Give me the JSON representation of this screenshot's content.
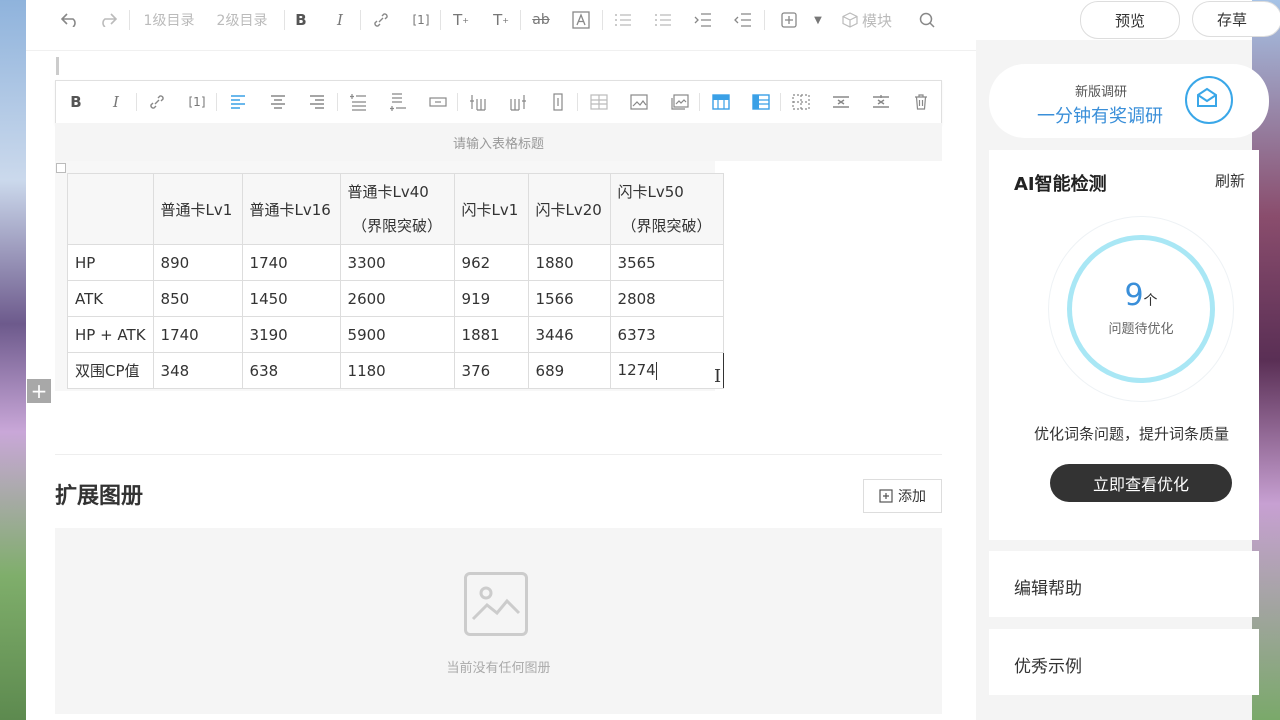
{
  "toolbar": {
    "heading1": "1级目录",
    "heading2": "2级目录",
    "module": "模块",
    "preview": "预览",
    "save": "存草"
  },
  "table_toolbar": {
    "icons": [
      "bold",
      "italic",
      "link",
      "reference",
      "align-left",
      "align-center",
      "align-right",
      "insert-row-above",
      "insert-row-below",
      "delete-row",
      "insert-col-left",
      "insert-col-right",
      "delete-col",
      "merge-cells",
      "image",
      "gallery",
      "header-row",
      "header-col",
      "split-cells",
      "delete-row-alt",
      "delete-col-alt",
      "delete-table"
    ]
  },
  "table": {
    "caption_placeholder": "请输入表格标题",
    "header": [
      "",
      "普通卡Lv1",
      "普通卡Lv16",
      "普通卡Lv40\n（界限突破）",
      "闪卡Lv1",
      "闪卡Lv20",
      "闪卡Lv50\n（界限突破）"
    ],
    "header_lines": [
      [
        ""
      ],
      [
        "普通卡Lv1"
      ],
      [
        "普通卡Lv16"
      ],
      [
        "普通卡Lv40",
        "（界限突破）"
      ],
      [
        "闪卡Lv1"
      ],
      [
        "闪卡Lv20"
      ],
      [
        "闪卡Lv50",
        "（界限突破）"
      ]
    ],
    "rows": [
      [
        "HP",
        "890",
        "1740",
        "3300",
        "962",
        "1880",
        "3565"
      ],
      [
        "ATK",
        "850",
        "1450",
        "2600",
        "919",
        "1566",
        "2808"
      ],
      [
        "HP + ATK",
        "1740",
        "3190",
        "5900",
        "1881",
        "3446",
        "6373"
      ],
      [
        "双围CP值",
        "348",
        "638",
        "1180",
        "376",
        "689",
        "1274"
      ]
    ]
  },
  "album": {
    "title": "扩展图册",
    "add_label": "添加",
    "empty_text": "当前没有任何图册"
  },
  "sidebar": {
    "survey_small": "新版调研",
    "survey_big": "一分钟有奖调研",
    "ai_title": "AI智能检测",
    "refresh": "刷新",
    "issue_count": "9",
    "issue_unit": "个",
    "issue_label": "问题待优化",
    "description": "优化词条问题，提升词条质量",
    "action": "立即查看优化",
    "help": "编辑帮助",
    "examples": "优秀示例"
  },
  "colors": {
    "accent": "#3a8fd9",
    "ring": "#a9e7f5",
    "dark_button": "#333333"
  }
}
